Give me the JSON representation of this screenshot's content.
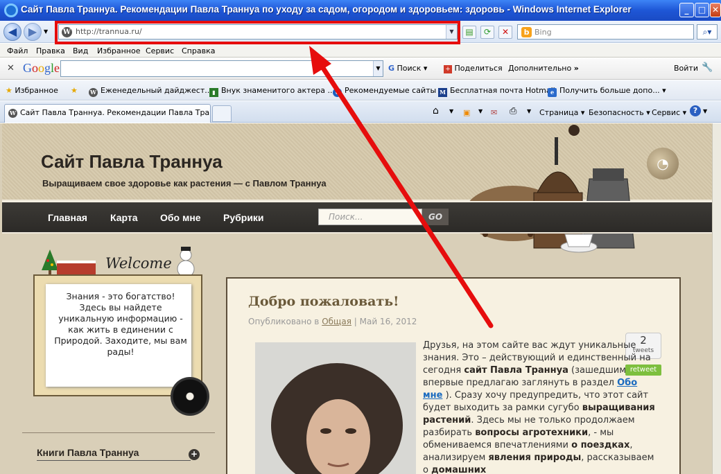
{
  "window": {
    "title": "Сайт Павла Траннуа. Рекомендации Павла Траннуа по уходу за садом, огородом и здоровьем: здоровь - Windows Internet Explorer",
    "min": "_",
    "max": "□",
    "close": "✕"
  },
  "nav": {
    "url": "http://trannua.ru/",
    "search_placeholder": "Bing"
  },
  "menu": [
    "Файл",
    "Правка",
    "Вид",
    "Избранное",
    "Сервис",
    "Справка"
  ],
  "google": {
    "logo": "Google",
    "search": "Поиск",
    "share": "Поделиться",
    "more": "Дополнительно",
    "login": "Войти"
  },
  "favorites": {
    "label": "Избранное",
    "items": [
      "Еженедельный дайджест...",
      "Внук знаменитого актера ...",
      "Рекомендуемые сайты",
      "Бесплатная почта Hotmail",
      "Получить больше допо..."
    ]
  },
  "tab": {
    "title": "Сайт Павла Траннуа. Рекомендации Павла Траннуа..."
  },
  "toolbar": {
    "page": "Страница",
    "safety": "Безопасность",
    "service": "Сервис"
  },
  "site": {
    "title": "Сайт Павла Траннуа",
    "tagline": "Выращиваем свое здоровье как растения — с Павлом Траннуа",
    "menu": [
      "Главная",
      "Карта",
      "Обо мне",
      "Рубрики"
    ],
    "search_placeholder": "Поиск...",
    "search_button": "GO"
  },
  "sidebar": {
    "welcome": "Welcome",
    "welcome_text": "Знания - это богатство! Здесь вы найдете уникальную информацию - как жить в единении с Природой. Заходите, мы вам рады!",
    "books_title": "Книги Павла Траннуа"
  },
  "post": {
    "title": "Добро пожаловать!",
    "meta_prefix": "Опубликовано в",
    "category": "Общая",
    "date": "Май 16, 2012",
    "tweet_count": "2",
    "tweet_label": "tweets",
    "retweet": "retweet",
    "p1": "Друзья, на этом сайте вас ждут уникальные знания. Это – действующий и единственный на сегодня ",
    "b1": "сайт Павла Траннуа",
    "p2": " (зашедшим впервые предлагаю заглянуть в раздел ",
    "link": "Обо мне",
    "p3": " ). Сразу хочу предупредить, что этот сайт будет выходить за рамки сугубо ",
    "b2": "выращивания растений",
    "p4": ". Здесь мы не только продолжаем разбирать ",
    "b3": "вопросы агротехники",
    "p5": ", - мы обмениваемся впечатлениями ",
    "b4": "о поездках",
    "p6": ", анализируем ",
    "b5": "явления природы",
    "p7": ", рассказываем о ",
    "b6": "домашних"
  }
}
